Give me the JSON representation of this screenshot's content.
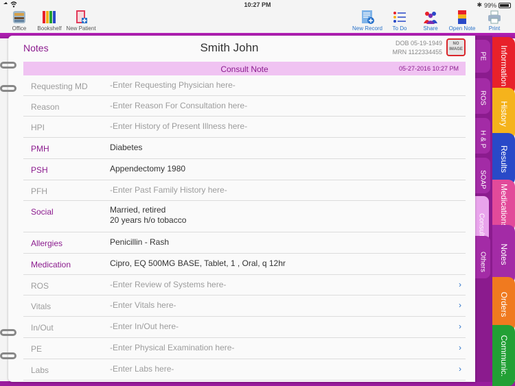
{
  "status_bar": {
    "time": "10:27 PM",
    "battery": "99%"
  },
  "toolbar": {
    "left": [
      {
        "label": "Office",
        "icon": "office-icon"
      },
      {
        "label": "Bookshelf",
        "icon": "bookshelf-icon"
      },
      {
        "label": "New Patient",
        "icon": "new-patient-icon"
      }
    ],
    "right": [
      {
        "label": "New Record",
        "icon": "new-record-icon"
      },
      {
        "label": "To Do",
        "icon": "todo-list-icon"
      },
      {
        "label": "Share",
        "icon": "share-people-icon"
      },
      {
        "label": "Open Note",
        "icon": "open-note-icon"
      },
      {
        "label": "Print",
        "icon": "printer-icon"
      }
    ]
  },
  "header": {
    "section_title": "Notes",
    "patient_name": "Smith John",
    "dob": "DOB 05-19-1949",
    "mrn": "MRN 1122334455",
    "avatar_text": "NO IMAGE"
  },
  "note": {
    "title": "Consult Note",
    "datetime": "05-27-2016 10:27 PM",
    "rows": [
      {
        "label": "Requesting MD",
        "value": "-Enter Requesting Physician here-",
        "filled": false,
        "chevron": false
      },
      {
        "label": "Reason",
        "value": "-Enter Reason For Consultation here-",
        "filled": false,
        "chevron": false
      },
      {
        "label": "HPI",
        "value": "-Enter History of Present Illness here-",
        "filled": false,
        "chevron": false
      },
      {
        "label": "PMH",
        "value": "Diabetes",
        "filled": true,
        "chevron": false
      },
      {
        "label": "PSH",
        "value": "Appendectomy 1980",
        "filled": true,
        "chevron": false
      },
      {
        "label": "PFH",
        "value": "-Enter Past Family History here-",
        "filled": false,
        "chevron": false
      },
      {
        "label": "Social",
        "value": "Married, retired",
        "value2": "20 years h/o tobacco",
        "filled": true,
        "chevron": false
      },
      {
        "label": "Allergies",
        "value": "Penicillin  - Rash",
        "filled": true,
        "chevron": false
      },
      {
        "label": "Medication",
        "value": "Cipro, EQ 500MG BASE, Tablet, 1 , Oral, q 12hr",
        "filled": true,
        "chevron": false
      },
      {
        "label": "ROS",
        "value": "-Enter Review of Systems here-",
        "filled": false,
        "chevron": true
      },
      {
        "label": "Vitals",
        "value": "-Enter Vitals here-",
        "filled": false,
        "chevron": true
      },
      {
        "label": "In/Out",
        "value": "-Enter In/Out here-",
        "filled": false,
        "chevron": true
      },
      {
        "label": "PE",
        "value": "-Enter Physical Examination here-",
        "filled": false,
        "chevron": true
      },
      {
        "label": "Labs",
        "value": "-Enter Labs here-",
        "filled": false,
        "chevron": true
      }
    ]
  },
  "inner_tabs": [
    {
      "label": "PE",
      "active": false
    },
    {
      "label": "ROS",
      "active": false
    },
    {
      "label": "H & P",
      "active": false
    },
    {
      "label": "SOAP",
      "active": false
    },
    {
      "label": "Consult",
      "active": true
    },
    {
      "label": "Others",
      "active": false
    }
  ],
  "outer_tabs": [
    {
      "label": "Information",
      "color": "#e8212a"
    },
    {
      "label": "History",
      "color": "#f5b31c"
    },
    {
      "label": "Results",
      "color": "#2949c8"
    },
    {
      "label": "Medications",
      "color": "#e24a9a"
    },
    {
      "label": "Notes",
      "color": "#a32ba6"
    },
    {
      "label": "Orders",
      "color": "#f07a1f"
    },
    {
      "label": "Communic.",
      "color": "#22a035"
    }
  ],
  "colors": {
    "accent": "#8b1b8e",
    "link": "#2a72c9"
  }
}
